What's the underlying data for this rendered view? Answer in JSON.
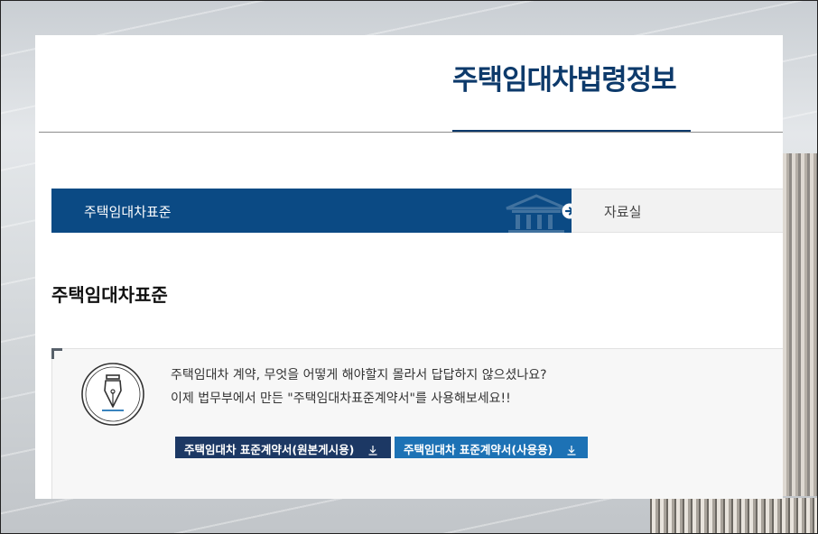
{
  "site": {
    "title": "주택임대차법령정보"
  },
  "tabs": [
    {
      "label": "주택임대차표준",
      "active": true
    },
    {
      "label": "자료실",
      "active": false
    }
  ],
  "page": {
    "heading": "주택임대차표준"
  },
  "info": {
    "line1": "주택임대차 계약, 무엇을 어떻게 해야할지 몰라서 답답하지 않으셨나요?",
    "line2": "이제 법무부에서 만든 \"주택임대차표준계약서\"를 사용해보세요!!"
  },
  "buttons": {
    "download_original": "주택임대차 표준계약서(원본게시용)",
    "download_usage": "주택임대차 표준계약서(사용용)"
  },
  "icons": {
    "tab_arrow": "arrow-right-circle-icon",
    "tab_decoration": "building-icon",
    "info": "fountain-pen-icon",
    "download": "download-icon"
  },
  "colors": {
    "brand_navy": "#0d3a6b",
    "tab_active": "#0b4a84",
    "button_dark": "#1c3864",
    "button_blue": "#1d72b5"
  }
}
